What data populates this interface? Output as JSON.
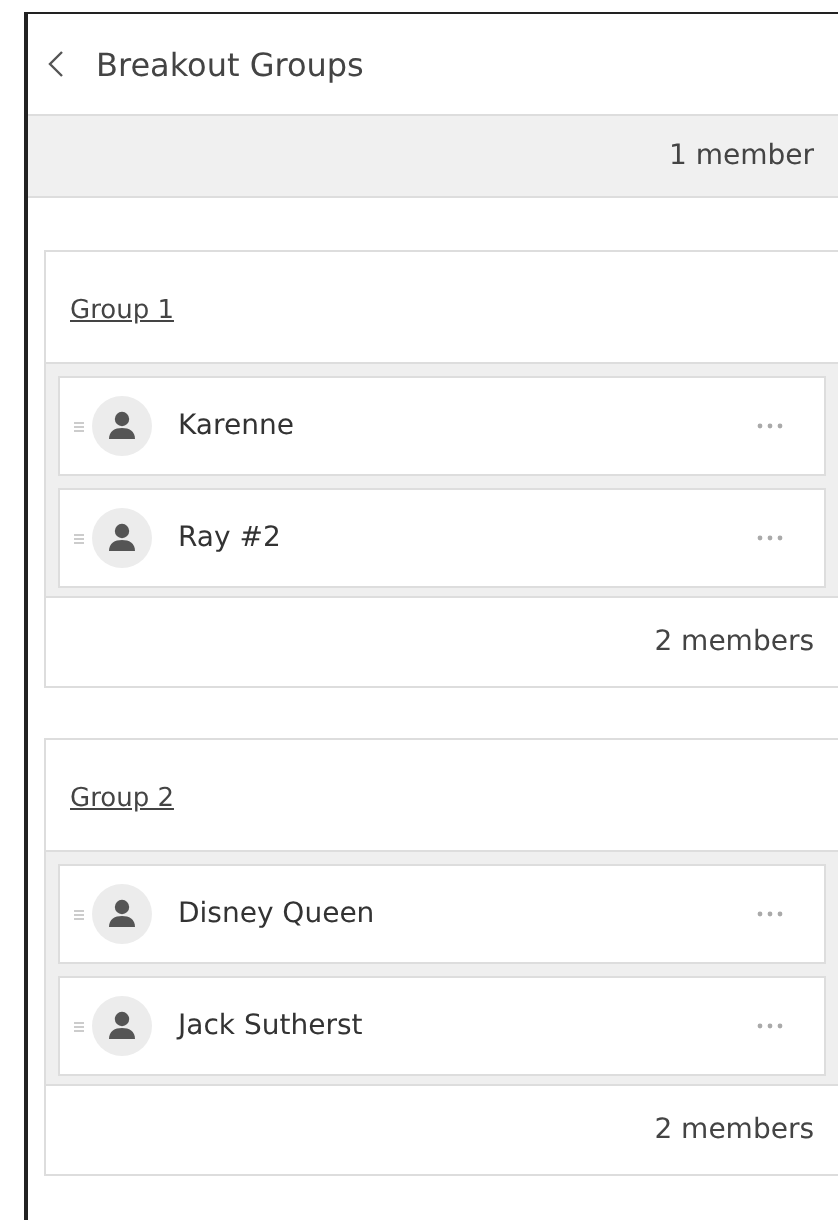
{
  "header": {
    "title": "Breakout Groups"
  },
  "unassigned": {
    "count": "1 member"
  },
  "groups": [
    {
      "name": "Group 1",
      "members": [
        {
          "name": "Karenne"
        },
        {
          "name": "Ray #2"
        }
      ],
      "count": "2 members"
    },
    {
      "name": "Group 2",
      "members": [
        {
          "name": "Disney Queen"
        },
        {
          "name": "Jack Sutherst"
        }
      ],
      "count": "2 members"
    }
  ]
}
